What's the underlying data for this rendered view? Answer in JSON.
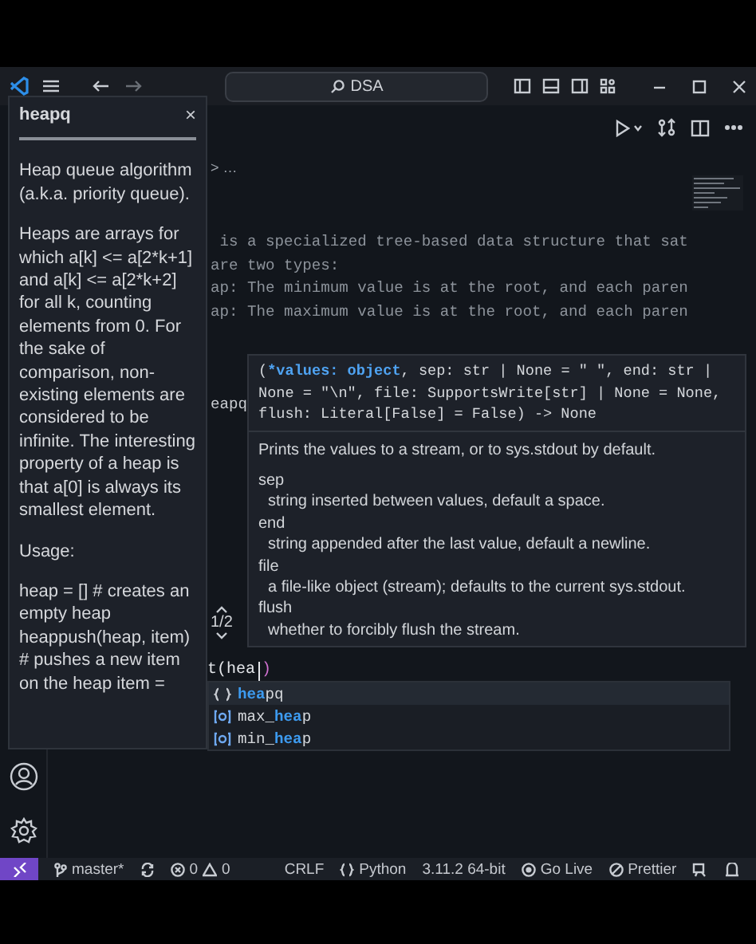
{
  "title_bar": {
    "search": "DSA"
  },
  "breadcrumb": "> …",
  "code": {
    "doc_lines": [
      " is a specialized tree-based data structure that sat",
      "are two types:",
      "ap: The minimum value is at the root, and each paren",
      "ap: The maximum value is at the root, and each paren"
    ],
    "import_line": "eapq",
    "current_line": "t(hea",
    "current_line_after_cursor": ")"
  },
  "doc_hover": {
    "title": "heapq",
    "close": "×",
    "paragraphs": [
      "Heap queue algorithm (a.k.a. priority queue).",
      "Heaps are arrays for which a[k] <= a[2*k+1] and a[k] <= a[2*k+2] for all k, counting elements from 0. For the sake of comparison, non-existing elements are considered to be infinite. The interesting property of a heap is that a[0] is always its smallest element.",
      "Usage:",
      "heap = [] # creates an empty heap heappush(heap, item) # pushes a new item on the heap item ="
    ]
  },
  "signature_hover": {
    "open": "(",
    "active_parameter": "*values: object",
    "rest": ", sep: str | None = \" \", end: str | None = \"\\n\", file: SupportsWrite[str] | None = None, flush: Literal[False] = False) -> None",
    "summary": "Prints the values to a stream, or to sys.stdout by default.",
    "params": [
      {
        "name": "sep",
        "description": "string inserted between values, default a space."
      },
      {
        "name": "end",
        "description": "string appended after the last value, default a newline."
      },
      {
        "name": "file",
        "description": "a file-like object (stream); defaults to the current sys.stdout."
      },
      {
        "name": "flush",
        "description": "whether to forcibly flush the stream."
      }
    ],
    "overload": "1/2"
  },
  "completions": [
    {
      "kind": "module",
      "match": "hea",
      "after": "pq",
      "selected": true
    },
    {
      "kind": "variable",
      "before": "max_",
      "match": "hea",
      "after": "p",
      "selected": false
    },
    {
      "kind": "variable",
      "before": "min_",
      "match": "hea",
      "after": "p",
      "selected": false
    }
  ],
  "status_bar": {
    "branch": "master*",
    "errors": "0",
    "warnings": "0",
    "eol": "CRLF",
    "language": "Python",
    "interpreter": "3.11.2 64-bit",
    "live": "Go Live",
    "formatter": "Prettier"
  }
}
